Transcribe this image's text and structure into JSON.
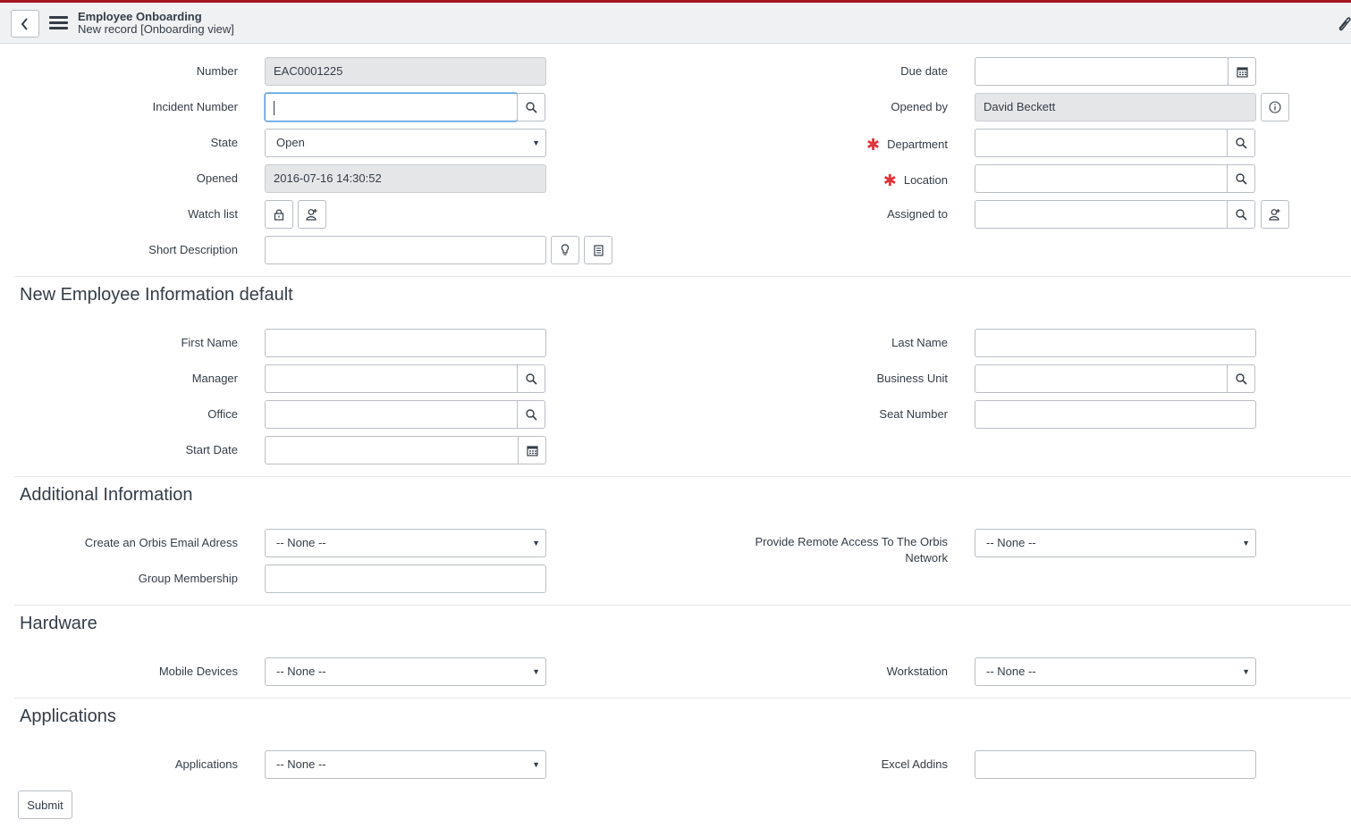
{
  "header": {
    "title": "Employee Onboarding",
    "subtitle": "New record [Onboarding view]",
    "icons": {
      "back": "chevron-left-icon",
      "menu": "hamburger-menu-icon",
      "attachment": "paperclip-icon"
    }
  },
  "colors": {
    "brand_top_bar": "#a3141c",
    "required": "#e0343a",
    "focus": "#5b9ee6",
    "readonly_bg": "#e5e6e8"
  },
  "top_form": {
    "number": {
      "label": "Number",
      "value": "EAC0001225"
    },
    "incident_number": {
      "label": "Incident Number",
      "value": ""
    },
    "state": {
      "label": "State",
      "value": "Open"
    },
    "opened": {
      "label": "Opened",
      "value": "2016-07-16 14:30:52"
    },
    "watch_list": {
      "label": "Watch list"
    },
    "short_description": {
      "label": "Short Description",
      "value": ""
    },
    "due_date": {
      "label": "Due date",
      "value": ""
    },
    "opened_by": {
      "label": "Opened by",
      "value": "David Beckett"
    },
    "department": {
      "label": "Department",
      "required": true,
      "value": ""
    },
    "location": {
      "label": "Location",
      "required": true,
      "value": ""
    },
    "assigned_to": {
      "label": "Assigned to",
      "value": ""
    },
    "required_marker": "✱"
  },
  "sections": {
    "new_employee": {
      "title": "New Employee Information default",
      "first_name": {
        "label": "First Name",
        "value": ""
      },
      "manager": {
        "label": "Manager",
        "value": ""
      },
      "office": {
        "label": "Office",
        "value": ""
      },
      "start_date": {
        "label": "Start Date",
        "value": ""
      },
      "last_name": {
        "label": "Last Name",
        "value": ""
      },
      "business_unit": {
        "label": "Business Unit",
        "value": ""
      },
      "seat_number": {
        "label": "Seat Number",
        "value": ""
      }
    },
    "additional": {
      "title": "Additional Information",
      "email": {
        "label": "Create an Orbis Email Adress",
        "value": "-- None --"
      },
      "group_membership": {
        "label": "Group Membership",
        "value": ""
      },
      "remote_access": {
        "label": "Provide Remote Access To The Orbis Network",
        "value": "-- None --"
      }
    },
    "hardware": {
      "title": "Hardware",
      "mobile_devices": {
        "label": "Mobile Devices",
        "value": "-- None --"
      },
      "workstation": {
        "label": "Workstation",
        "value": "-- None --"
      }
    },
    "applications": {
      "title": "Applications",
      "applications": {
        "label": "Applications",
        "value": "-- None --"
      },
      "excel_addins": {
        "label": "Excel Addins",
        "value": ""
      }
    }
  },
  "submit_label": "Submit"
}
